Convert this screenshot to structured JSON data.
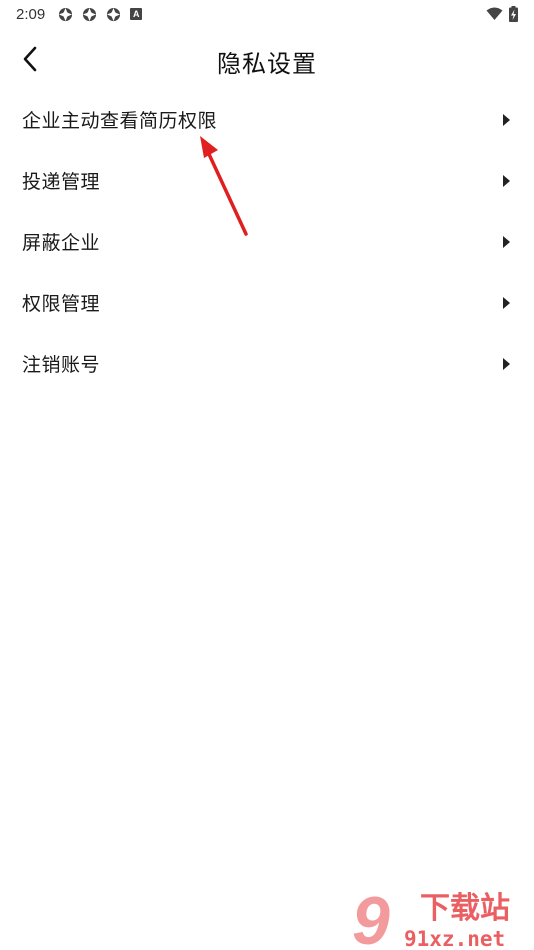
{
  "status_bar": {
    "time": "2:09",
    "app_icons": [
      "target-icon",
      "target-icon",
      "target-icon"
    ],
    "badge_letter": "A",
    "right_icons": [
      "wifi-icon",
      "battery-charging-icon"
    ]
  },
  "header": {
    "title": "隐私设置",
    "back_icon": "chevron-left-icon"
  },
  "menu": {
    "items": [
      {
        "label": "企业主动查看简历权限"
      },
      {
        "label": "投递管理"
      },
      {
        "label": "屏蔽企业"
      },
      {
        "label": "权限管理"
      },
      {
        "label": "注销账号"
      }
    ]
  },
  "annotation": {
    "color": "#e02020"
  },
  "watermark": {
    "title": "下载站",
    "domain": "91xz.net",
    "logo_mark": "9",
    "colors": {
      "primary": "#e5383b",
      "secondary": "#f07a7c"
    }
  }
}
